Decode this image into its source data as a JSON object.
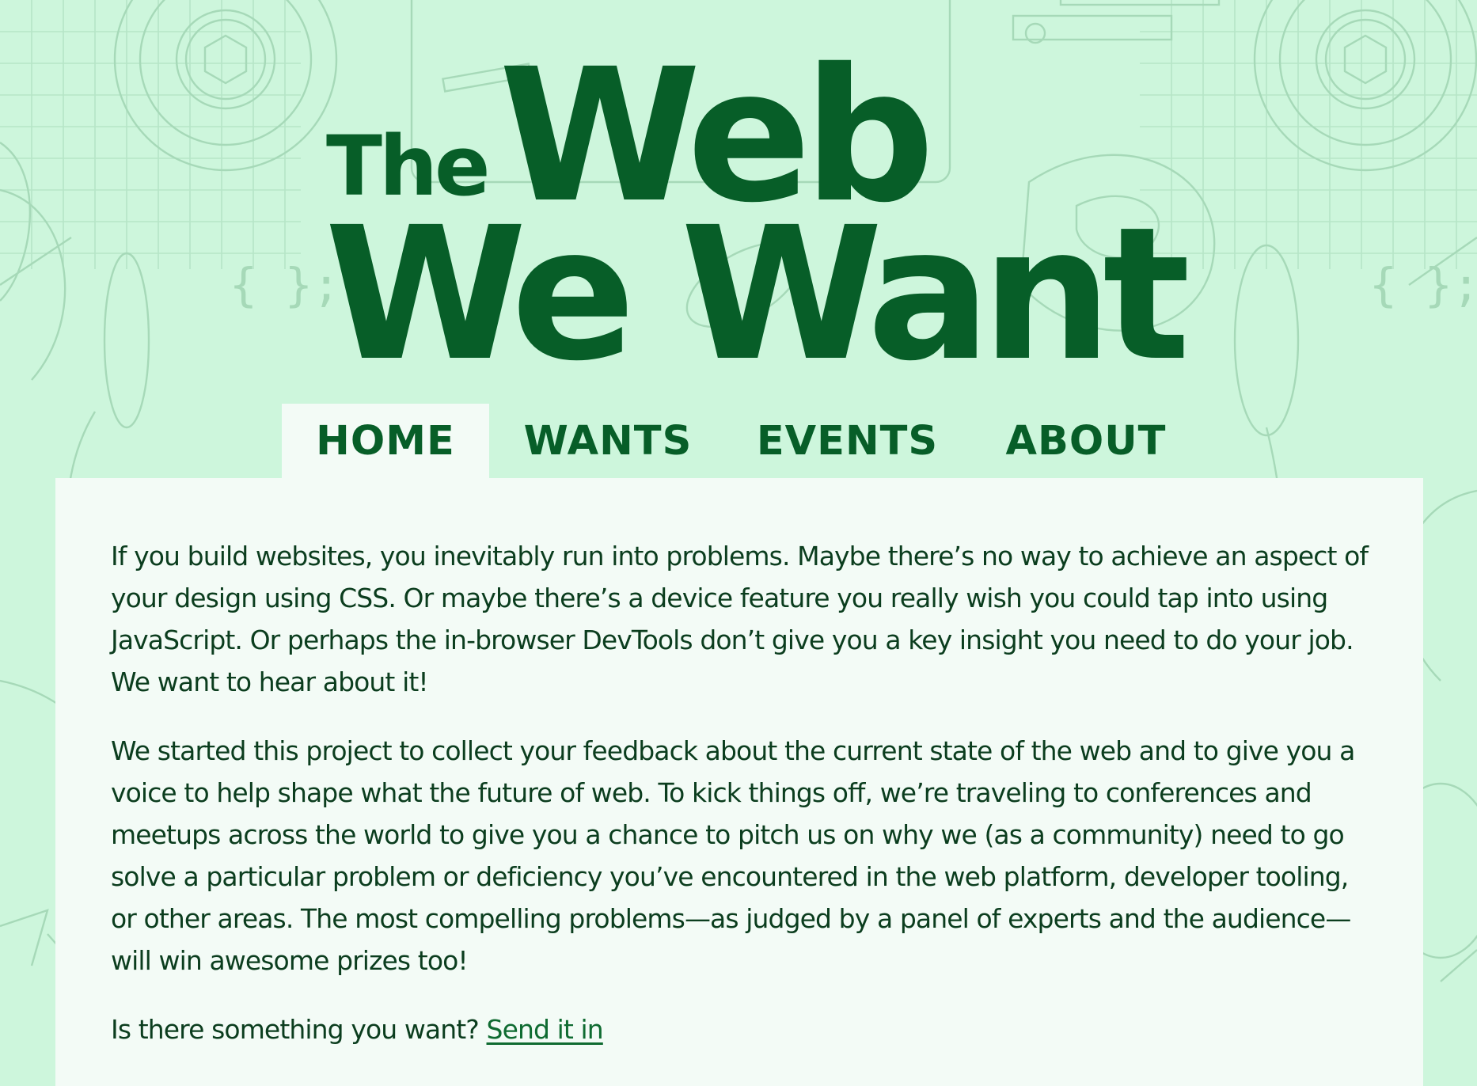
{
  "logo": {
    "the": "The",
    "web": "Web",
    "we_want": "We Want"
  },
  "nav": {
    "tabs": [
      {
        "label": "HOME",
        "active": true
      },
      {
        "label": "WANTS",
        "active": false
      },
      {
        "label": "EVENTS",
        "active": false
      },
      {
        "label": "ABOUT",
        "active": false
      }
    ]
  },
  "content": {
    "paragraphs": [
      "If you build websites, you inevitably run into problems. Maybe there’s no way to achieve an aspect of your design using CSS. Or maybe there’s a device feature you really wish you could tap into using JavaScript. Or perhaps the in-browser DevTools don’t give you a key insight you need to do your job. We want to hear about it!",
      "We started this project to collect your feedback about the current state of the web and to give you a voice to help shape what the future of web. To kick things off, we’re traveling to conferences and meetups across the world to give you a chance to pitch us on why we (as a community) need to go solve a particular problem or deficiency you’ve encountered in the web platform, developer tooling, or other areas. The most compelling problems—as judged by a panel of experts and the audience—will win awesome prizes too!"
    ],
    "cta_text": "Is there something you want?",
    "cta_link": "Send it in"
  },
  "background": {
    "code_glyph": "{ };"
  },
  "colors": {
    "background": "#cdf6dc",
    "brand_green": "#075e28",
    "panel": "#f3fbf6",
    "text": "#0b3d1e",
    "pattern_line": "#a6d9b8"
  }
}
